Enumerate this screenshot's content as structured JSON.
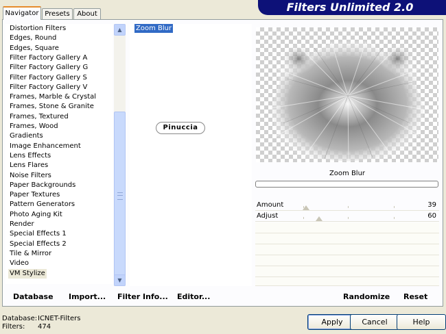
{
  "app_title": "Filters Unlimited 2.0",
  "tabs": [
    "Navigator",
    "Presets",
    "About"
  ],
  "active_tab": "Navigator",
  "categories": [
    "Distortion Filters",
    "Edges, Round",
    "Edges, Square",
    "Filter Factory Gallery A",
    "Filter Factory Gallery G",
    "Filter Factory Gallery S",
    "Filter Factory Gallery V",
    "Frames, Marble & Crystal",
    "Frames, Stone & Granite",
    "Frames, Textured",
    "Frames, Wood",
    "Gradients",
    "Image Enhancement",
    "Lens Effects",
    "Lens Flares",
    "Noise Filters",
    "Paper Backgrounds",
    "Paper Textures",
    "Pattern Generators",
    "Photo Aging Kit",
    "Render",
    "Special Effects 1",
    "Special Effects 2",
    "Tile & Mirror",
    "Video",
    "VM Stylize"
  ],
  "selected_category": "VM Stylize",
  "filters": [
    "Zoom Blur"
  ],
  "selected_filter": "Zoom Blur",
  "watermark": "Pinuccia",
  "filter_name": "Zoom Blur",
  "controls": [
    {
      "label": "Amount",
      "value": 39,
      "max": 255
    },
    {
      "label": "Adjust",
      "value": 60,
      "max": 255
    }
  ],
  "bottom_bar": {
    "database": "Database",
    "import": "Import...",
    "filter_info": "Filter Info...",
    "editor": "Editor...",
    "randomize": "Randomize",
    "reset": "Reset"
  },
  "footer": {
    "database_label": "Database:",
    "database_value": "ICNET-Filters",
    "filters_label": "Filters:",
    "filters_value": "474"
  },
  "buttons": {
    "apply": "Apply",
    "cancel": "Cancel",
    "help": "Help"
  },
  "colors": {
    "title_bg": "#0d1178",
    "selection": "#316ac5",
    "tab_accent": "#e68b2c"
  }
}
